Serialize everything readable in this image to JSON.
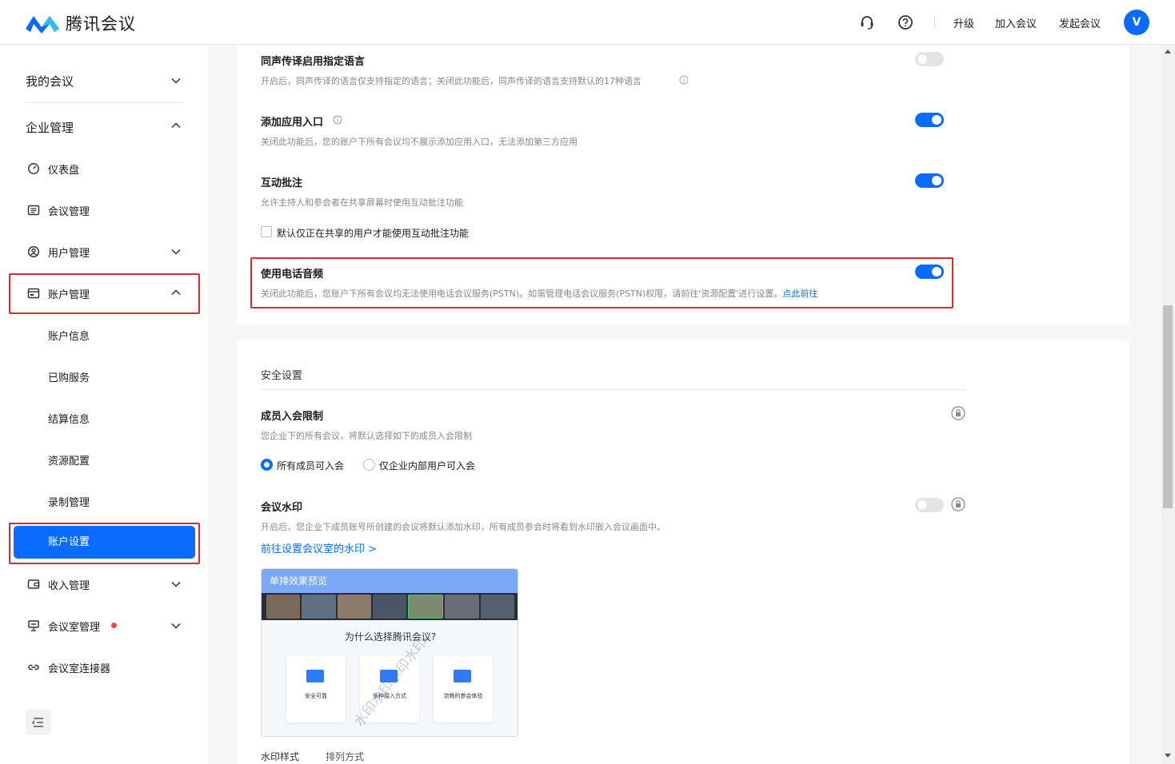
{
  "app": {
    "name": "腾讯会议"
  },
  "header": {
    "upgrade": "升级",
    "join_meeting": "加入会议",
    "start_meeting": "发起会议",
    "avatar_initial": "V"
  },
  "sidebar": {
    "my_meetings": "我的会议",
    "enterprise_management": "企业管理",
    "items": [
      {
        "label": "仪表盘"
      },
      {
        "label": "会议管理"
      },
      {
        "label": "用户管理"
      },
      {
        "label": "账户管理"
      },
      {
        "label": "收入管理"
      },
      {
        "label": "会议室管理"
      },
      {
        "label": "会议室连接器"
      }
    ],
    "account_sub": [
      "账户信息",
      "已购服务",
      "结算信息",
      "资源配置",
      "录制管理",
      "账户设置"
    ]
  },
  "settings": {
    "simultaneous_lang": {
      "title": "同声传译启用指定语言",
      "desc": "开启后，同声传译的语言仅支持指定的语言；关闭此功能后，同声传译的语言支持默认的17种语言",
      "enabled": false
    },
    "add_app_entry": {
      "title": "添加应用入口",
      "desc": "关闭此功能后，您的账户下所有会议均不展示添加应用入口，无法添加第三方应用",
      "enabled": true
    },
    "annotation": {
      "title": "互动批注",
      "desc": "允许主持人和参会者在共享屏幕时使用互动批注功能",
      "enabled": true,
      "checkbox_label": "默认仅正在共享的用户才能使用互动批注功能",
      "checked": false
    },
    "phone_audio": {
      "title": "使用电话音频",
      "desc": "关闭此功能后，您账户下所有会议均无法使用电话会议服务(PSTN)。如需管理电话会议服务(PSTN)权限，请前往'资源配置'进行设置。",
      "link": "点此前往",
      "enabled": true
    }
  },
  "security": {
    "section_title": "安全设置",
    "member_restriction": {
      "title": "成员入会限制",
      "desc": "您企业下的所有会议，将默认选择如下的成员入会限制",
      "options": [
        "所有成员可入会",
        "仅企业内部用户可入会"
      ],
      "selected": 0
    },
    "watermark": {
      "title": "会议水印",
      "desc": "开启后，您企业下成员账号所创建的会议将默认添加水印，所有成员参会时将看到水印嵌入会议画面中。",
      "link": "前往设置会议室的水印",
      "link_arrow": ">",
      "enabled": false,
      "preview": {
        "header": "单排效果预览",
        "question": "为什么选择腾讯会议?",
        "cards": [
          "安全可靠",
          "多种接入方式",
          "流畅的参会体验"
        ],
        "watermark_text": "水印水印水印水印"
      },
      "style_label": "水印样式",
      "layout_label": "排列方式"
    }
  },
  "colors": {
    "accent": "#0a6cff",
    "highlight_border": "#e0282e"
  }
}
